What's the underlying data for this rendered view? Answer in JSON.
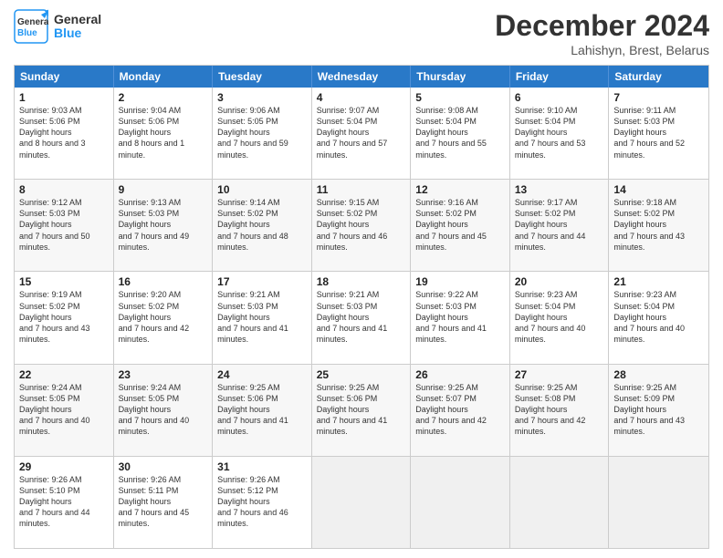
{
  "logo": {
    "line1": "General",
    "line2": "Blue"
  },
  "title": "December 2024",
  "subtitle": "Lahishyn, Brest, Belarus",
  "headers": [
    "Sunday",
    "Monday",
    "Tuesday",
    "Wednesday",
    "Thursday",
    "Friday",
    "Saturday"
  ],
  "weeks": [
    [
      {
        "day": "1",
        "rise": "9:03 AM",
        "set": "5:06 PM",
        "daylight": "8 hours and 3 minutes."
      },
      {
        "day": "2",
        "rise": "9:04 AM",
        "set": "5:06 PM",
        "daylight": "8 hours and 1 minute."
      },
      {
        "day": "3",
        "rise": "9:06 AM",
        "set": "5:05 PM",
        "daylight": "7 hours and 59 minutes."
      },
      {
        "day": "4",
        "rise": "9:07 AM",
        "set": "5:04 PM",
        "daylight": "7 hours and 57 minutes."
      },
      {
        "day": "5",
        "rise": "9:08 AM",
        "set": "5:04 PM",
        "daylight": "7 hours and 55 minutes."
      },
      {
        "day": "6",
        "rise": "9:10 AM",
        "set": "5:04 PM",
        "daylight": "7 hours and 53 minutes."
      },
      {
        "day": "7",
        "rise": "9:11 AM",
        "set": "5:03 PM",
        "daylight": "7 hours and 52 minutes."
      }
    ],
    [
      {
        "day": "8",
        "rise": "9:12 AM",
        "set": "5:03 PM",
        "daylight": "7 hours and 50 minutes."
      },
      {
        "day": "9",
        "rise": "9:13 AM",
        "set": "5:03 PM",
        "daylight": "7 hours and 49 minutes."
      },
      {
        "day": "10",
        "rise": "9:14 AM",
        "set": "5:02 PM",
        "daylight": "7 hours and 48 minutes."
      },
      {
        "day": "11",
        "rise": "9:15 AM",
        "set": "5:02 PM",
        "daylight": "7 hours and 46 minutes."
      },
      {
        "day": "12",
        "rise": "9:16 AM",
        "set": "5:02 PM",
        "daylight": "7 hours and 45 minutes."
      },
      {
        "day": "13",
        "rise": "9:17 AM",
        "set": "5:02 PM",
        "daylight": "7 hours and 44 minutes."
      },
      {
        "day": "14",
        "rise": "9:18 AM",
        "set": "5:02 PM",
        "daylight": "7 hours and 43 minutes."
      }
    ],
    [
      {
        "day": "15",
        "rise": "9:19 AM",
        "set": "5:02 PM",
        "daylight": "7 hours and 43 minutes."
      },
      {
        "day": "16",
        "rise": "9:20 AM",
        "set": "5:02 PM",
        "daylight": "7 hours and 42 minutes."
      },
      {
        "day": "17",
        "rise": "9:21 AM",
        "set": "5:03 PM",
        "daylight": "7 hours and 41 minutes."
      },
      {
        "day": "18",
        "rise": "9:21 AM",
        "set": "5:03 PM",
        "daylight": "7 hours and 41 minutes."
      },
      {
        "day": "19",
        "rise": "9:22 AM",
        "set": "5:03 PM",
        "daylight": "7 hours and 41 minutes."
      },
      {
        "day": "20",
        "rise": "9:23 AM",
        "set": "5:04 PM",
        "daylight": "7 hours and 40 minutes."
      },
      {
        "day": "21",
        "rise": "9:23 AM",
        "set": "5:04 PM",
        "daylight": "7 hours and 40 minutes."
      }
    ],
    [
      {
        "day": "22",
        "rise": "9:24 AM",
        "set": "5:05 PM",
        "daylight": "7 hours and 40 minutes."
      },
      {
        "day": "23",
        "rise": "9:24 AM",
        "set": "5:05 PM",
        "daylight": "7 hours and 40 minutes."
      },
      {
        "day": "24",
        "rise": "9:25 AM",
        "set": "5:06 PM",
        "daylight": "7 hours and 41 minutes."
      },
      {
        "day": "25",
        "rise": "9:25 AM",
        "set": "5:06 PM",
        "daylight": "7 hours and 41 minutes."
      },
      {
        "day": "26",
        "rise": "9:25 AM",
        "set": "5:07 PM",
        "daylight": "7 hours and 42 minutes."
      },
      {
        "day": "27",
        "rise": "9:25 AM",
        "set": "5:08 PM",
        "daylight": "7 hours and 42 minutes."
      },
      {
        "day": "28",
        "rise": "9:25 AM",
        "set": "5:09 PM",
        "daylight": "7 hours and 43 minutes."
      }
    ],
    [
      {
        "day": "29",
        "rise": "9:26 AM",
        "set": "5:10 PM",
        "daylight": "7 hours and 44 minutes."
      },
      {
        "day": "30",
        "rise": "9:26 AM",
        "set": "5:11 PM",
        "daylight": "7 hours and 45 minutes."
      },
      {
        "day": "31",
        "rise": "9:26 AM",
        "set": "5:12 PM",
        "daylight": "7 hours and 46 minutes."
      },
      null,
      null,
      null,
      null
    ]
  ]
}
